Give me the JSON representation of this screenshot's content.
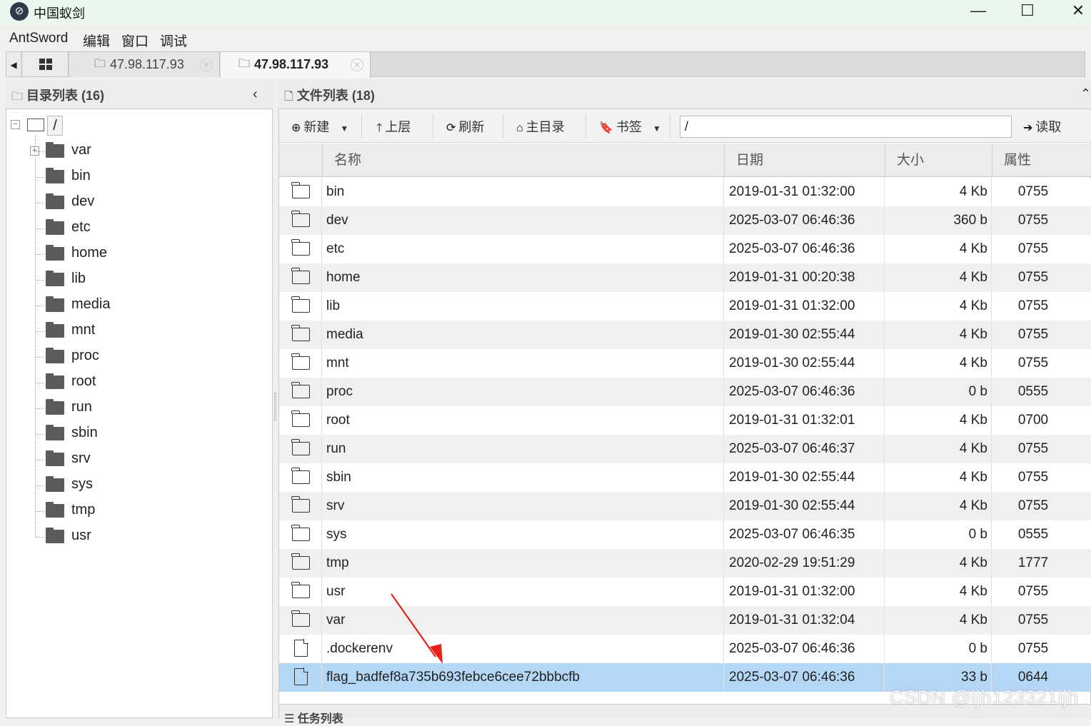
{
  "window": {
    "title": "中国蚁剑",
    "controls": {
      "minimize": "—",
      "maximize": "☐",
      "close": "✕"
    }
  },
  "menu": [
    "AntSword",
    "编辑",
    "窗口",
    "调试"
  ],
  "tabs": [
    {
      "label": "47.98.117.93",
      "active": false
    },
    {
      "label": "47.98.117.93",
      "active": true
    }
  ],
  "dir_panel": {
    "title": "目录列表 (16)",
    "root": "/",
    "items": [
      "var",
      "bin",
      "dev",
      "etc",
      "home",
      "lib",
      "media",
      "mnt",
      "proc",
      "root",
      "run",
      "sbin",
      "srv",
      "sys",
      "tmp",
      "usr"
    ]
  },
  "file_panel": {
    "title": "文件列表 (18)",
    "toolbar": {
      "new": "新建",
      "up": "上层",
      "refresh": "刷新",
      "home": "主目录",
      "bookmark": "书签",
      "path": "/",
      "read": "读取"
    },
    "columns": [
      "名称",
      "日期",
      "大小",
      "属性"
    ],
    "rows": [
      {
        "type": "folder",
        "name": "bin",
        "date": "2019-01-31 01:32:00",
        "size": "4 Kb",
        "attr": "0755"
      },
      {
        "type": "folder",
        "name": "dev",
        "date": "2025-03-07 06:46:36",
        "size": "360 b",
        "attr": "0755"
      },
      {
        "type": "folder",
        "name": "etc",
        "date": "2025-03-07 06:46:36",
        "size": "4 Kb",
        "attr": "0755"
      },
      {
        "type": "folder",
        "name": "home",
        "date": "2019-01-31 00:20:38",
        "size": "4 Kb",
        "attr": "0755"
      },
      {
        "type": "folder",
        "name": "lib",
        "date": "2019-01-31 01:32:00",
        "size": "4 Kb",
        "attr": "0755"
      },
      {
        "type": "folder",
        "name": "media",
        "date": "2019-01-30 02:55:44",
        "size": "4 Kb",
        "attr": "0755"
      },
      {
        "type": "folder",
        "name": "mnt",
        "date": "2019-01-30 02:55:44",
        "size": "4 Kb",
        "attr": "0755"
      },
      {
        "type": "folder",
        "name": "proc",
        "date": "2025-03-07 06:46:36",
        "size": "0 b",
        "attr": "0555"
      },
      {
        "type": "folder",
        "name": "root",
        "date": "2019-01-31 01:32:01",
        "size": "4 Kb",
        "attr": "0700"
      },
      {
        "type": "folder",
        "name": "run",
        "date": "2025-03-07 06:46:37",
        "size": "4 Kb",
        "attr": "0755"
      },
      {
        "type": "folder",
        "name": "sbin",
        "date": "2019-01-30 02:55:44",
        "size": "4 Kb",
        "attr": "0755"
      },
      {
        "type": "folder",
        "name": "srv",
        "date": "2019-01-30 02:55:44",
        "size": "4 Kb",
        "attr": "0755"
      },
      {
        "type": "folder",
        "name": "sys",
        "date": "2025-03-07 06:46:35",
        "size": "0 b",
        "attr": "0555"
      },
      {
        "type": "folder",
        "name": "tmp",
        "date": "2020-02-29 19:51:29",
        "size": "4 Kb",
        "attr": "1777"
      },
      {
        "type": "folder",
        "name": "usr",
        "date": "2019-01-31 01:32:00",
        "size": "4 Kb",
        "attr": "0755"
      },
      {
        "type": "folder",
        "name": "var",
        "date": "2019-01-31 01:32:04",
        "size": "4 Kb",
        "attr": "0755"
      },
      {
        "type": "file",
        "name": ".dockerenv",
        "date": "2025-03-07 06:46:36",
        "size": "0 b",
        "attr": "0755"
      },
      {
        "type": "file",
        "name": "flag_badfef8a735b693febce6cee72bbbcfb",
        "date": "2025-03-07 06:46:36",
        "size": "33 b",
        "attr": "0644",
        "selected": true
      }
    ]
  },
  "task_panel": {
    "title": "任务列表"
  },
  "watermark": "CSDN @ljh123321ljh",
  "colors": {
    "selected_row": "#b5d7f6",
    "arrow": "#e8211b",
    "titlebar": "#eaf6ee"
  }
}
